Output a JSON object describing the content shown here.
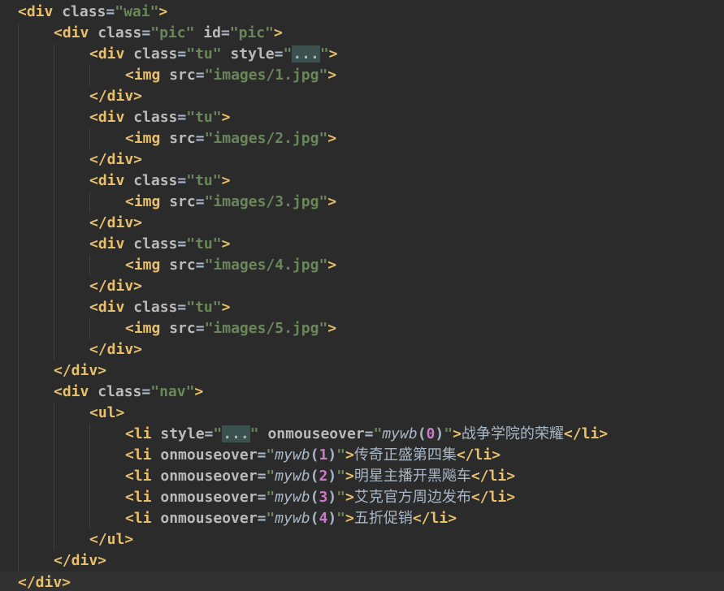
{
  "editor": {
    "language": "html",
    "colors": {
      "background": "#2b2b2b",
      "tag": "#e8bf6a",
      "attribute": "#bababa",
      "string": "#6a8759",
      "number": "#cc7ac8",
      "text": "#a9b7c6"
    },
    "lines": [
      {
        "indent": 0,
        "tokens": [
          {
            "t": "tag",
            "v": "<div"
          },
          {
            "t": "sp",
            "v": " "
          },
          {
            "t": "attr",
            "v": "class"
          },
          {
            "t": "punct",
            "v": "="
          },
          {
            "t": "str",
            "v": "\"wai\""
          },
          {
            "t": "tag",
            "v": ">"
          }
        ]
      },
      {
        "indent": 1,
        "tokens": [
          {
            "t": "tag",
            "v": "<div"
          },
          {
            "t": "sp",
            "v": " "
          },
          {
            "t": "attr",
            "v": "class"
          },
          {
            "t": "punct",
            "v": "="
          },
          {
            "t": "str",
            "v": "\"pic\""
          },
          {
            "t": "sp",
            "v": " "
          },
          {
            "t": "attr",
            "v": "id"
          },
          {
            "t": "punct",
            "v": "="
          },
          {
            "t": "str",
            "v": "\"pic\""
          },
          {
            "t": "tag",
            "v": ">"
          }
        ]
      },
      {
        "indent": 2,
        "tokens": [
          {
            "t": "tag",
            "v": "<div"
          },
          {
            "t": "sp",
            "v": " "
          },
          {
            "t": "attr",
            "v": "class"
          },
          {
            "t": "punct",
            "v": "="
          },
          {
            "t": "str",
            "v": "\"tu\""
          },
          {
            "t": "sp",
            "v": " "
          },
          {
            "t": "attr",
            "v": "style"
          },
          {
            "t": "punct",
            "v": "="
          },
          {
            "t": "str",
            "v": "\""
          },
          {
            "t": "fold",
            "v": "..."
          },
          {
            "t": "str",
            "v": "\""
          },
          {
            "t": "tag",
            "v": ">"
          }
        ]
      },
      {
        "indent": 3,
        "tokens": [
          {
            "t": "tag",
            "v": "<img"
          },
          {
            "t": "sp",
            "v": " "
          },
          {
            "t": "attr",
            "v": "src"
          },
          {
            "t": "punct",
            "v": "="
          },
          {
            "t": "str",
            "v": "\"images/1.jpg\""
          },
          {
            "t": "tag",
            "v": ">"
          }
        ]
      },
      {
        "indent": 2,
        "tokens": [
          {
            "t": "tag",
            "v": "</div>"
          }
        ]
      },
      {
        "indent": 2,
        "tokens": [
          {
            "t": "tag",
            "v": "<div"
          },
          {
            "t": "sp",
            "v": " "
          },
          {
            "t": "attr",
            "v": "class"
          },
          {
            "t": "punct",
            "v": "="
          },
          {
            "t": "str",
            "v": "\"tu\""
          },
          {
            "t": "tag",
            "v": ">"
          }
        ]
      },
      {
        "indent": 3,
        "tokens": [
          {
            "t": "tag",
            "v": "<img"
          },
          {
            "t": "sp",
            "v": " "
          },
          {
            "t": "attr",
            "v": "src"
          },
          {
            "t": "punct",
            "v": "="
          },
          {
            "t": "str",
            "v": "\"images/2.jpg\""
          },
          {
            "t": "tag",
            "v": ">"
          }
        ]
      },
      {
        "indent": 2,
        "tokens": [
          {
            "t": "tag",
            "v": "</div>"
          }
        ]
      },
      {
        "indent": 2,
        "tokens": [
          {
            "t": "tag",
            "v": "<div"
          },
          {
            "t": "sp",
            "v": " "
          },
          {
            "t": "attr",
            "v": "class"
          },
          {
            "t": "punct",
            "v": "="
          },
          {
            "t": "str",
            "v": "\"tu\""
          },
          {
            "t": "tag",
            "v": ">"
          }
        ]
      },
      {
        "indent": 3,
        "tokens": [
          {
            "t": "tag",
            "v": "<img"
          },
          {
            "t": "sp",
            "v": " "
          },
          {
            "t": "attr",
            "v": "src"
          },
          {
            "t": "punct",
            "v": "="
          },
          {
            "t": "str",
            "v": "\"images/3.jpg\""
          },
          {
            "t": "tag",
            "v": ">"
          }
        ]
      },
      {
        "indent": 2,
        "tokens": [
          {
            "t": "tag",
            "v": "</div>"
          }
        ]
      },
      {
        "indent": 2,
        "tokens": [
          {
            "t": "tag",
            "v": "<div"
          },
          {
            "t": "sp",
            "v": " "
          },
          {
            "t": "attr",
            "v": "class"
          },
          {
            "t": "punct",
            "v": "="
          },
          {
            "t": "str",
            "v": "\"tu\""
          },
          {
            "t": "tag",
            "v": ">"
          }
        ]
      },
      {
        "indent": 3,
        "tokens": [
          {
            "t": "tag",
            "v": "<img"
          },
          {
            "t": "sp",
            "v": " "
          },
          {
            "t": "attr",
            "v": "src"
          },
          {
            "t": "punct",
            "v": "="
          },
          {
            "t": "str",
            "v": "\"images/4.jpg\""
          },
          {
            "t": "tag",
            "v": ">"
          }
        ]
      },
      {
        "indent": 2,
        "tokens": [
          {
            "t": "tag",
            "v": "</div>"
          }
        ]
      },
      {
        "indent": 2,
        "tokens": [
          {
            "t": "tag",
            "v": "<div"
          },
          {
            "t": "sp",
            "v": " "
          },
          {
            "t": "attr",
            "v": "class"
          },
          {
            "t": "punct",
            "v": "="
          },
          {
            "t": "str",
            "v": "\"tu\""
          },
          {
            "t": "tag",
            "v": ">"
          }
        ]
      },
      {
        "indent": 3,
        "tokens": [
          {
            "t": "tag",
            "v": "<img"
          },
          {
            "t": "sp",
            "v": " "
          },
          {
            "t": "attr",
            "v": "src"
          },
          {
            "t": "punct",
            "v": "="
          },
          {
            "t": "str",
            "v": "\"images/5.jpg\""
          },
          {
            "t": "tag",
            "v": ">"
          }
        ]
      },
      {
        "indent": 2,
        "tokens": [
          {
            "t": "tag",
            "v": "</div>"
          }
        ]
      },
      {
        "indent": 1,
        "tokens": [
          {
            "t": "tag",
            "v": "</div>"
          }
        ]
      },
      {
        "indent": 1,
        "tokens": [
          {
            "t": "tag",
            "v": "<div"
          },
          {
            "t": "sp",
            "v": " "
          },
          {
            "t": "attr",
            "v": "class"
          },
          {
            "t": "punct",
            "v": "="
          },
          {
            "t": "str",
            "v": "\"nav\""
          },
          {
            "t": "tag",
            "v": ">"
          }
        ]
      },
      {
        "indent": 2,
        "tokens": [
          {
            "t": "tag",
            "v": "<ul>"
          }
        ]
      },
      {
        "indent": 3,
        "tokens": [
          {
            "t": "tag",
            "v": "<li"
          },
          {
            "t": "sp",
            "v": " "
          },
          {
            "t": "attr",
            "v": "style"
          },
          {
            "t": "punct",
            "v": "="
          },
          {
            "t": "str",
            "v": "\""
          },
          {
            "t": "fold",
            "v": "..."
          },
          {
            "t": "str",
            "v": "\""
          },
          {
            "t": "sp",
            "v": " "
          },
          {
            "t": "attr",
            "v": "onmouseover"
          },
          {
            "t": "punct",
            "v": "="
          },
          {
            "t": "str",
            "v": "\""
          },
          {
            "t": "func",
            "v": "mywb"
          },
          {
            "t": "punct",
            "v": "("
          },
          {
            "t": "num",
            "v": "0"
          },
          {
            "t": "punct",
            "v": ")"
          },
          {
            "t": "str",
            "v": "\""
          },
          {
            "t": "tag",
            "v": ">"
          },
          {
            "t": "text",
            "v": "战争学院的荣耀"
          },
          {
            "t": "tag",
            "v": "</li>"
          }
        ]
      },
      {
        "indent": 3,
        "tokens": [
          {
            "t": "tag",
            "v": "<li"
          },
          {
            "t": "sp",
            "v": " "
          },
          {
            "t": "attr",
            "v": "onmouseover"
          },
          {
            "t": "punct",
            "v": "="
          },
          {
            "t": "str",
            "v": "\""
          },
          {
            "t": "func",
            "v": "mywb"
          },
          {
            "t": "punct",
            "v": "("
          },
          {
            "t": "num",
            "v": "1"
          },
          {
            "t": "punct",
            "v": ")"
          },
          {
            "t": "str",
            "v": "\""
          },
          {
            "t": "tag",
            "v": ">"
          },
          {
            "t": "text",
            "v": "传奇正盛第四集"
          },
          {
            "t": "tag",
            "v": "</li>"
          }
        ]
      },
      {
        "indent": 3,
        "tokens": [
          {
            "t": "tag",
            "v": "<li"
          },
          {
            "t": "sp",
            "v": " "
          },
          {
            "t": "attr",
            "v": "onmouseover"
          },
          {
            "t": "punct",
            "v": "="
          },
          {
            "t": "str",
            "v": "\""
          },
          {
            "t": "func",
            "v": "mywb"
          },
          {
            "t": "punct",
            "v": "("
          },
          {
            "t": "num",
            "v": "2"
          },
          {
            "t": "punct",
            "v": ")"
          },
          {
            "t": "str",
            "v": "\""
          },
          {
            "t": "tag",
            "v": ">"
          },
          {
            "t": "text",
            "v": "明星主播开黑飚车"
          },
          {
            "t": "tag",
            "v": "</li>"
          }
        ]
      },
      {
        "indent": 3,
        "tokens": [
          {
            "t": "tag",
            "v": "<li"
          },
          {
            "t": "sp",
            "v": " "
          },
          {
            "t": "attr",
            "v": "onmouseover"
          },
          {
            "t": "punct",
            "v": "="
          },
          {
            "t": "str",
            "v": "\""
          },
          {
            "t": "func",
            "v": "mywb"
          },
          {
            "t": "punct",
            "v": "("
          },
          {
            "t": "num",
            "v": "3"
          },
          {
            "t": "punct",
            "v": ")"
          },
          {
            "t": "str",
            "v": "\""
          },
          {
            "t": "tag",
            "v": ">"
          },
          {
            "t": "text",
            "v": "艾克官方周边发布"
          },
          {
            "t": "tag",
            "v": "</li>"
          }
        ]
      },
      {
        "indent": 3,
        "tokens": [
          {
            "t": "tag",
            "v": "<li"
          },
          {
            "t": "sp",
            "v": " "
          },
          {
            "t": "attr",
            "v": "onmouseover"
          },
          {
            "t": "punct",
            "v": "="
          },
          {
            "t": "str",
            "v": "\""
          },
          {
            "t": "func",
            "v": "mywb"
          },
          {
            "t": "punct",
            "v": "("
          },
          {
            "t": "num",
            "v": "4"
          },
          {
            "t": "punct",
            "v": ")"
          },
          {
            "t": "str",
            "v": "\""
          },
          {
            "t": "tag",
            "v": ">"
          },
          {
            "t": "text",
            "v": "五折促销"
          },
          {
            "t": "tag",
            "v": "</li>"
          }
        ]
      },
      {
        "indent": 2,
        "tokens": [
          {
            "t": "tag",
            "v": "</ul>"
          }
        ]
      },
      {
        "indent": 1,
        "tokens": [
          {
            "t": "tag",
            "v": "</div>"
          }
        ]
      },
      {
        "indent": 0,
        "current": true,
        "tokens": [
          {
            "t": "tag",
            "v": "</div>"
          }
        ]
      }
    ]
  }
}
